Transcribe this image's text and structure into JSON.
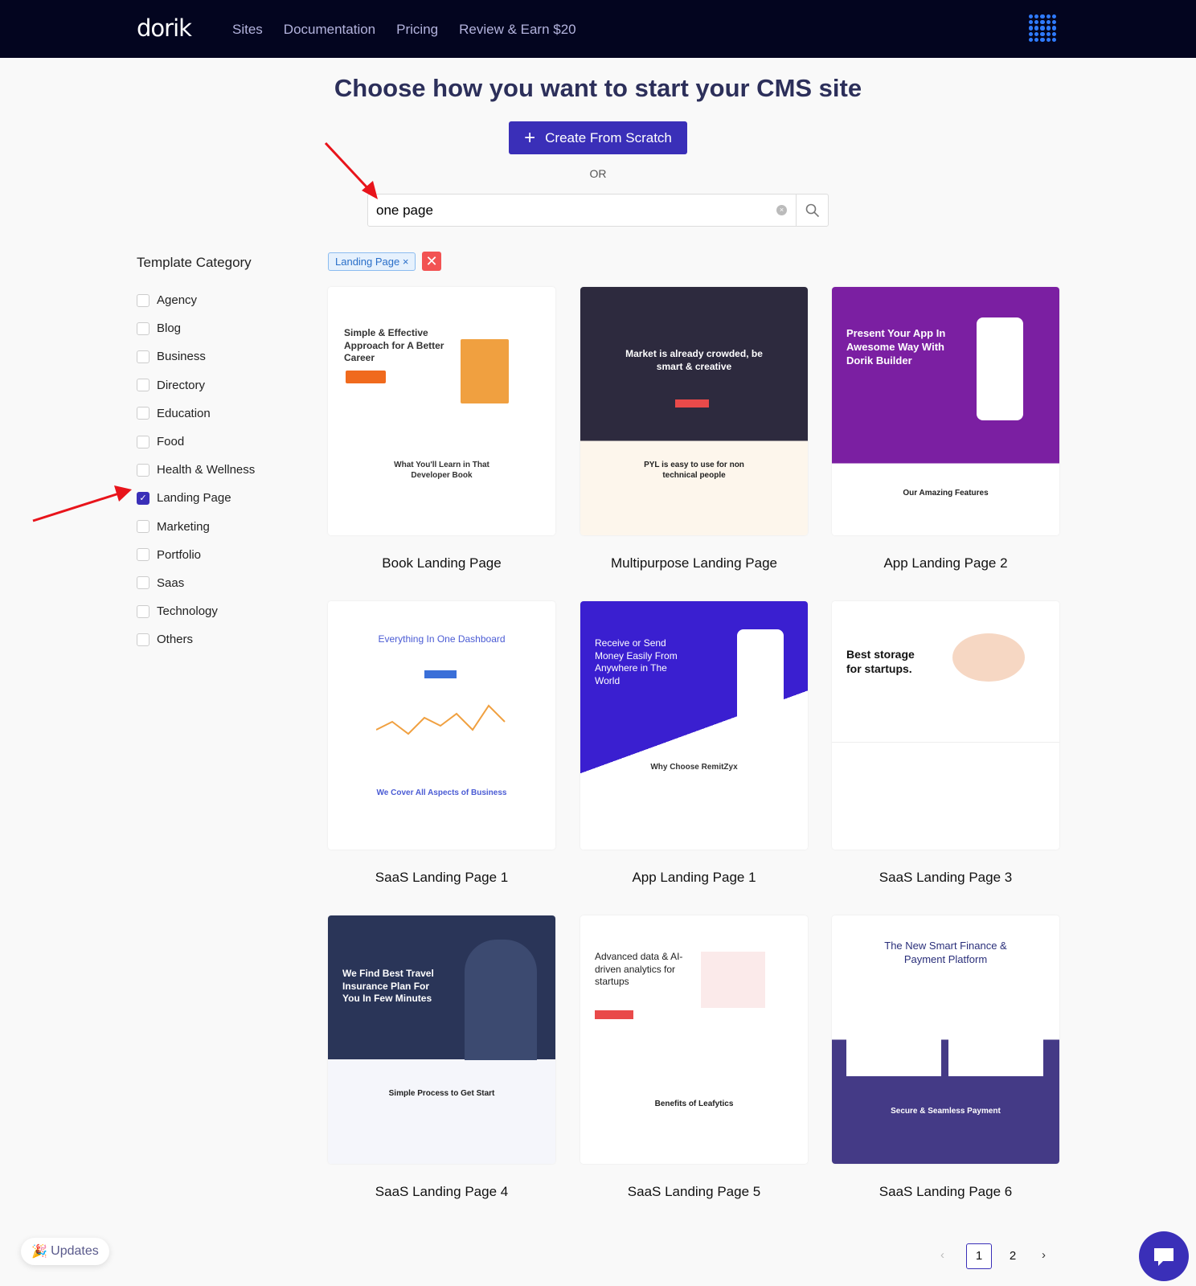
{
  "header": {
    "logo": "dorik",
    "nav": [
      "Sites",
      "Documentation",
      "Pricing",
      "Review & Earn $20"
    ]
  },
  "main": {
    "title": "Choose how you want to start your CMS site",
    "create_label": "Create From Scratch",
    "or": "OR",
    "search": {
      "value": "one page",
      "clear_icon": "clear-icon",
      "search_icon": "search-icon"
    }
  },
  "sidebar": {
    "title": "Template Category",
    "items": [
      {
        "label": "Agency",
        "checked": false
      },
      {
        "label": "Blog",
        "checked": false
      },
      {
        "label": "Business",
        "checked": false
      },
      {
        "label": "Directory",
        "checked": false
      },
      {
        "label": "Education",
        "checked": false
      },
      {
        "label": "Food",
        "checked": false
      },
      {
        "label": "Health & Wellness",
        "checked": false
      },
      {
        "label": "Landing Page",
        "checked": true
      },
      {
        "label": "Marketing",
        "checked": false
      },
      {
        "label": "Portfolio",
        "checked": false
      },
      {
        "label": "Saas",
        "checked": false
      },
      {
        "label": "Technology",
        "checked": false
      },
      {
        "label": "Others",
        "checked": false
      }
    ]
  },
  "filters": {
    "active_tag": "Landing Page"
  },
  "templates": [
    {
      "name": "Book Landing Page",
      "headline": "Simple & Effective Approach for A Better Career",
      "sub": "What You'll Learn in That Developer Book"
    },
    {
      "name": "Multipurpose Landing Page",
      "headline": "Market is already crowded, be smart & creative",
      "sub": "PYL is easy to use for non technical people"
    },
    {
      "name": "App Landing Page 2",
      "headline": "Present Your App In Awesome Way With Dorik Builder",
      "sub": "Our Amazing Features"
    },
    {
      "name": "SaaS Landing Page 1",
      "headline": "Everything In One Dashboard",
      "sub": "We Cover All Aspects of Business"
    },
    {
      "name": "App Landing Page 1",
      "headline": "Receive or Send Money Easily From Anywhere in The World",
      "sub": "Why Choose RemitZyx"
    },
    {
      "name": "SaaS Landing Page 3",
      "headline": "Best storage for startups.",
      "sub": ""
    },
    {
      "name": "SaaS Landing Page 4",
      "headline": "We Find Best Travel Insurance Plan For You In Few Minutes",
      "sub": "Simple Process to Get Start"
    },
    {
      "name": "SaaS Landing Page 5",
      "headline": "Advanced data & AI-driven analytics for startups",
      "sub": "Benefits of Leafytics"
    },
    {
      "name": "SaaS Landing Page 6",
      "headline": "The New Smart Finance & Payment Platform",
      "sub": "Secure & Seamless Payment"
    }
  ],
  "pagination": {
    "current": "1",
    "pages": [
      "1",
      "2"
    ]
  },
  "updates_label": "Updates",
  "colors": {
    "header": "#03051f",
    "accent": "#3a2fb8",
    "danger": "#f25353"
  }
}
